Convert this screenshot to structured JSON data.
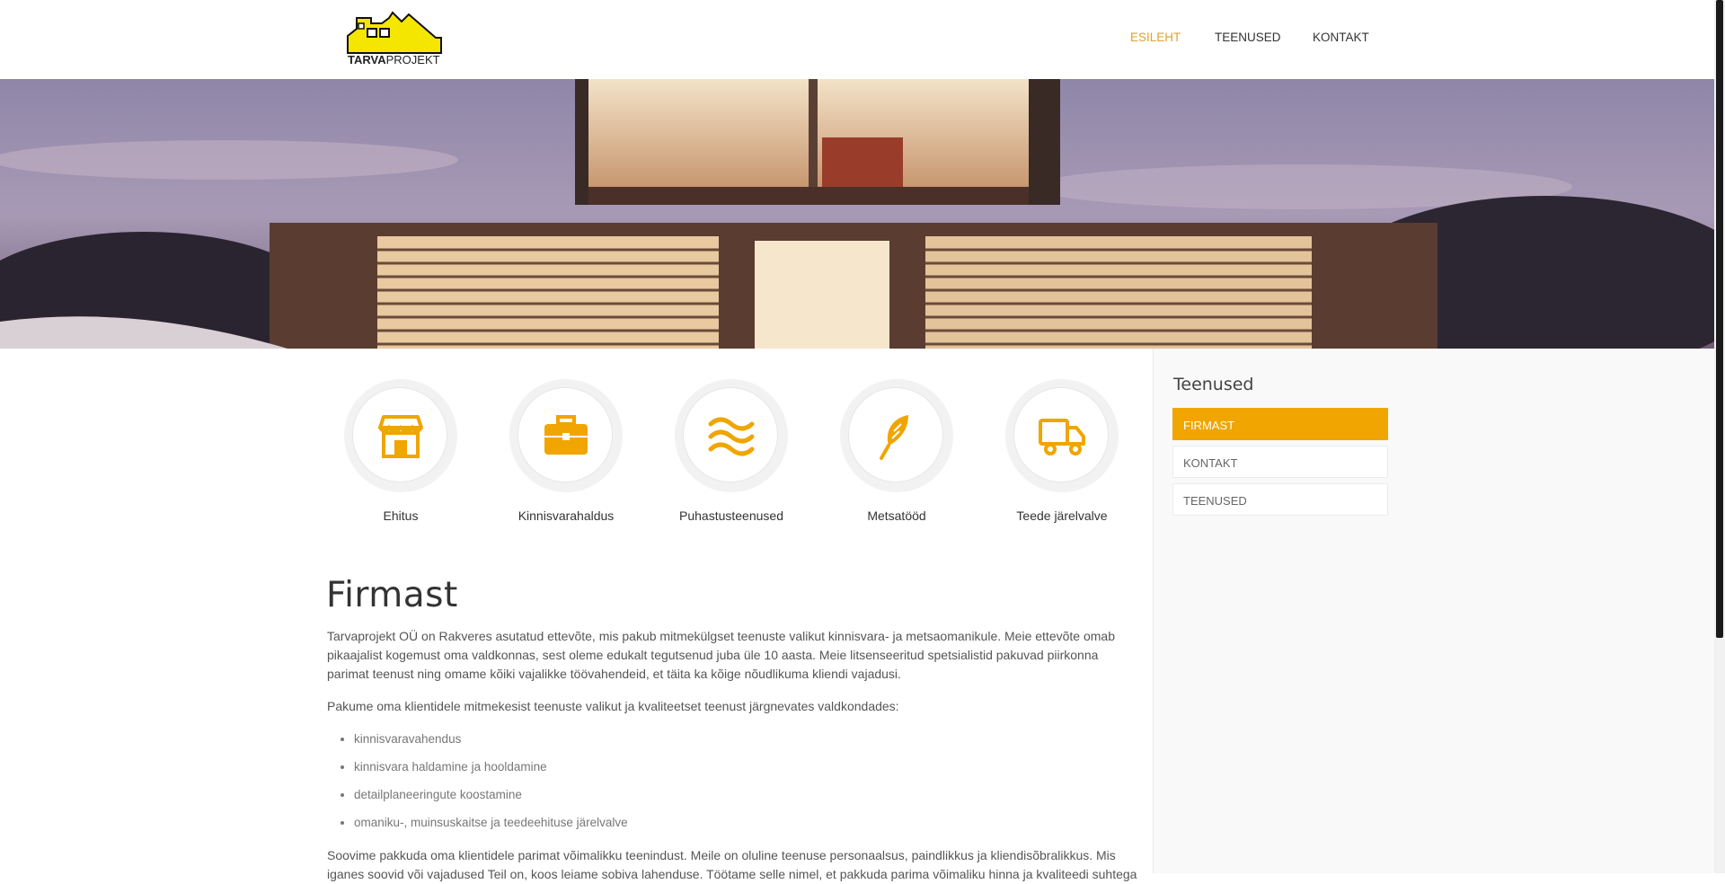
{
  "header": {
    "logo_text_bold": "TARVA",
    "logo_text_thin": "PROJEKT",
    "nav": [
      {
        "label": "ESILEHT",
        "active": true
      },
      {
        "label": "TEENUSED",
        "active": false
      },
      {
        "label": "KONTAKT",
        "active": false
      }
    ]
  },
  "services": [
    {
      "label": "Ehitus",
      "icon": "store-icon"
    },
    {
      "label": "Kinnisvarahaldus",
      "icon": "briefcase-icon"
    },
    {
      "label": "Puhastusteenused",
      "icon": "waves-icon"
    },
    {
      "label": "Metsatööd",
      "icon": "feather-icon"
    },
    {
      "label": "Teede järelvalve",
      "icon": "truck-icon"
    }
  ],
  "article": {
    "title": "Firmast",
    "p1": "Tarvaprojekt OÜ on Rakveres asutatud ettevõte, mis pakub mitmekülgset teenuste valikut kinnisvara- ja metsaomanikule. Meie ettevõte omab pikaajalist kogemust oma valdkonnas, sest oleme edukalt tegutsenud juba üle 10 aasta. Meie litsenseeritud spetsialistid pakuvad piirkonna parimat teenust ning omame kõiki vajalikke töövahendeid, et täita ka kõige nõudlikuma kliendi vajadusi.",
    "p2": "Pakume oma klientidele mitmekesist teenuste valikut ja kvaliteetset teenust järgnevates valdkondades:",
    "list": [
      "kinnisvaravahendus",
      "kinnisvara haldamine ja hooldamine",
      "detailplaneeringute koostamine",
      "omaniku-, muinsuskaitse ja teedeehituse järelvalve"
    ],
    "p3": "Soovime pakkuda oma klientidele parimat võimalikku teenindust. Meile on oluline teenuse personaalsus, paindlikkus ja kliendisõbralikkus. Mis iganes soovid või vajadused Teil on, koos leiame sobiva lahenduse. Töötame selle nimel, et pakkuda parima võimaliku hinna ja kvaliteedi suhtega"
  },
  "sidebar": {
    "title": "Teenused",
    "items": [
      {
        "label": "FIRMAST",
        "active": true
      },
      {
        "label": "KONTAKT",
        "active": false
      },
      {
        "label": "TEENUSED",
        "active": false
      }
    ]
  },
  "colors": {
    "accent": "#f0a500",
    "nav_active": "#e0a12a",
    "logo_yellow": "#f5e600"
  }
}
